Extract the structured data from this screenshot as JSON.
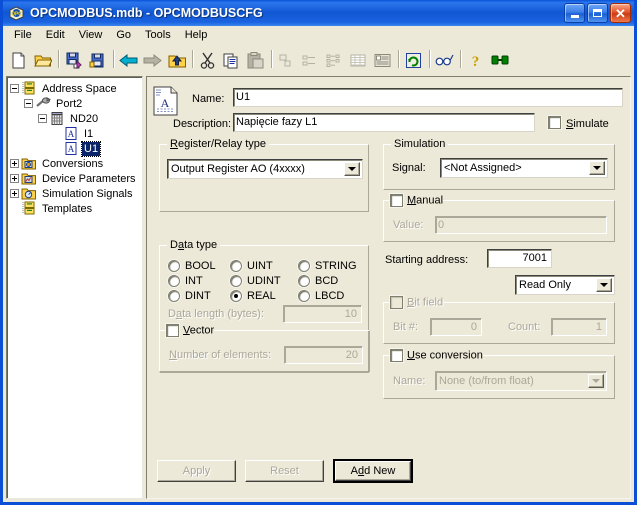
{
  "window": {
    "title": "OPCMODBUS.mdb - OPCMODBUSCFG",
    "app_icon": "opc-app-icon",
    "buttons": {
      "minimize": "minimize-button",
      "maximize": "maximize-button",
      "close": "close-button",
      "close_glyph": "✕"
    }
  },
  "menubar": {
    "items": [
      {
        "label": "File"
      },
      {
        "label": "Edit"
      },
      {
        "label": "View"
      },
      {
        "label": "Go"
      },
      {
        "label": "Tools"
      },
      {
        "label": "Help"
      }
    ]
  },
  "toolbar": {
    "buttons": [
      {
        "name": "new-icon"
      },
      {
        "name": "open-folder-icon"
      },
      {
        "sep": true
      },
      {
        "name": "save-as-icon"
      },
      {
        "name": "properties-icon"
      },
      {
        "sep": true
      },
      {
        "name": "back-arrow-icon"
      },
      {
        "name": "forward-arrow-icon"
      },
      {
        "name": "up-one-level-icon"
      },
      {
        "sep": true
      },
      {
        "name": "cut-icon"
      },
      {
        "name": "copy-icon"
      },
      {
        "name": "paste-icon"
      },
      {
        "sep": true
      },
      {
        "name": "large-icons-icon"
      },
      {
        "name": "small-icons-icon"
      },
      {
        "name": "list-icon"
      },
      {
        "name": "details-icon"
      },
      {
        "name": "report-icon"
      },
      {
        "sep": true
      },
      {
        "name": "refresh-icon"
      },
      {
        "sep": true
      },
      {
        "name": "monitor-glasses-icon"
      },
      {
        "sep": true
      },
      {
        "name": "help-icon"
      },
      {
        "name": "connect-icon"
      }
    ]
  },
  "tree": {
    "nodes": [
      {
        "label": "Address Space",
        "icon": "address-space-icon",
        "indent": 0,
        "expander": "minus",
        "selected": false
      },
      {
        "label": "Port2",
        "icon": "port-icon",
        "indent": 1,
        "expander": "minus",
        "selected": false
      },
      {
        "label": "ND20",
        "icon": "device-icon",
        "indent": 2,
        "expander": "minus",
        "selected": false
      },
      {
        "label": "I1",
        "icon": "tag-icon",
        "indent": 3,
        "expander": "none",
        "selected": false
      },
      {
        "label": "U1",
        "icon": "tag-icon",
        "indent": 3,
        "expander": "none",
        "selected": true
      },
      {
        "label": "Conversions",
        "icon": "conversions-folder-icon",
        "indent": 0,
        "expander": "plus",
        "selected": false
      },
      {
        "label": "Device Parameters",
        "icon": "device-parameters-folder-icon",
        "indent": 0,
        "expander": "plus",
        "selected": false
      },
      {
        "label": "Simulation Signals",
        "icon": "simulation-signals-folder-icon",
        "indent": 0,
        "expander": "plus",
        "selected": false
      },
      {
        "label": "Templates",
        "icon": "templates-icon",
        "indent": 0,
        "expander": "none",
        "selected": false
      }
    ]
  },
  "form": {
    "header_icon": "tag-document-icon",
    "name_label": "Name:",
    "name_value": "U1",
    "description_label": "Description:",
    "description_value": "Napięcie fazy L1",
    "simulate_label": "Simulate",
    "simulate_checked": false,
    "register_group": {
      "title": "Register/Relay type",
      "value": "Output Register AO (4xxxx)"
    },
    "datatype_group": {
      "title": "Data type",
      "options": [
        {
          "label": "BOOL",
          "selected": false
        },
        {
          "label": "UINT",
          "selected": false
        },
        {
          "label": "STRING",
          "selected": false
        },
        {
          "label": "INT",
          "selected": false
        },
        {
          "label": "UDINT",
          "selected": false
        },
        {
          "label": "BCD",
          "selected": false
        },
        {
          "label": "DINT",
          "selected": false
        },
        {
          "label": "REAL",
          "selected": true
        },
        {
          "label": "LBCD",
          "selected": false
        }
      ],
      "data_length_label": "Data length (bytes):",
      "data_length_value": "10",
      "vector_label": "Vector",
      "vector_checked": false,
      "elements_label": "Number of elements:",
      "elements_value": "20"
    },
    "simulation_group": {
      "title": "Simulation",
      "signal_label": "Signal:",
      "signal_value": "<Not Assigned>"
    },
    "manual_group": {
      "title": "Manual",
      "checked": false,
      "value_label": "Value:",
      "value": "0"
    },
    "starting_address_label": "Starting address:",
    "starting_address_value": "7001",
    "access_value": "Read Only",
    "bitfield_group": {
      "title": "Bit field",
      "checked": false,
      "bit_label": "Bit #:",
      "bit_value": "0",
      "count_label": "Count:",
      "count_value": "1"
    },
    "conversion_group": {
      "title": "Use conversion",
      "checked": false,
      "name_label": "Name:",
      "name_value": "None (to/from float)"
    },
    "buttons": {
      "apply": "Apply",
      "reset": "Reset",
      "add_new": "Add New"
    }
  },
  "colors": {
    "face": "#ece9d8",
    "title_blue": "#0a4fd6",
    "selection": "#0a246a",
    "disabled_text": "#aca899"
  }
}
